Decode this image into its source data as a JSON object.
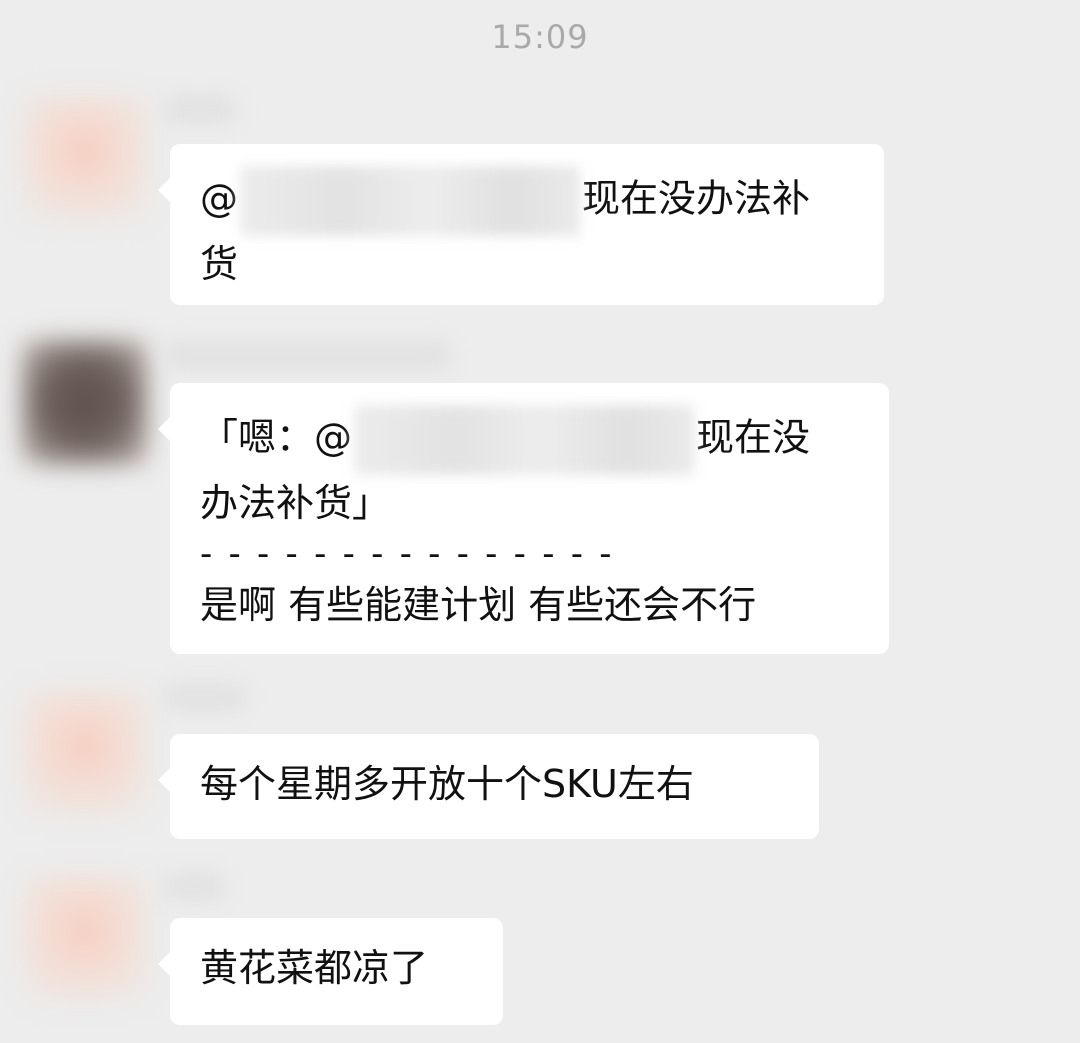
{
  "timestamp": "15:09",
  "messages": [
    {
      "avatar": "blurred-avatar",
      "sender": "",
      "text_prefix": "@",
      "text_suffix_line1": "现在没办法补",
      "text_line2": "货"
    },
    {
      "avatar": "blurred-avatar",
      "sender": "",
      "quote_prefix": "「嗯：@",
      "quote_suffix_line1": "现在没",
      "quote_line2": "办法补货」",
      "divider": "- - - - - - - - - - - - - - -",
      "reply": "是啊 有些能建计划 有些还会不行"
    },
    {
      "avatar": "blurred-avatar",
      "sender": "",
      "text": "每个星期多开放十个SKU左右"
    },
    {
      "avatar": "blurred-avatar",
      "sender": "",
      "text": "黄花菜都凉了"
    }
  ]
}
